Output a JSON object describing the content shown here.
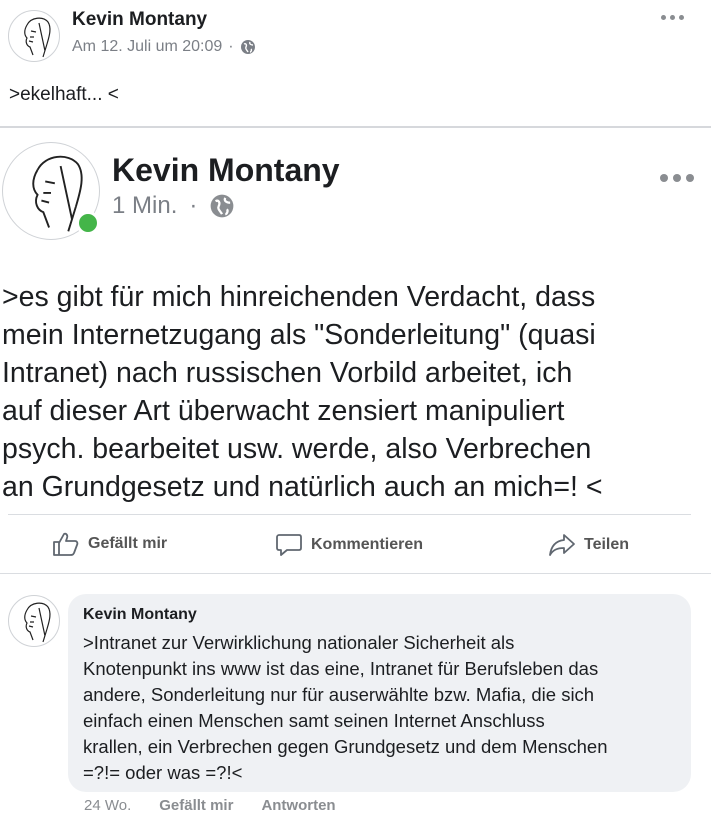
{
  "post1": {
    "author": "Kevin Montany",
    "timestamp": "Am 12. Juli um 20:09",
    "separator": "·",
    "privacy_icon": "globe-icon",
    "more_icon": "more-dots-icon",
    "text": ">ekelhaft... <"
  },
  "post2": {
    "author": "Kevin Montany",
    "timestamp": "1 Min.",
    "separator": "·",
    "privacy_icon": "globe-icon",
    "online_status_color": "#44b549",
    "more_icon": "more-dots-icon",
    "text_lines": [
      ">es gibt für mich hinreichenden Verdacht, dass",
      "mein Internetzugang als \"Sonderleitung\" (quasi",
      "Intranet) nach russischen Vorbild arbeitet, ich",
      "auf dieser Art überwacht zensiert manipuliert",
      "psych. bearbeitet usw. werde, also Verbrechen",
      "an Grundgesetz und natürlich auch an mich=! <"
    ]
  },
  "actions": {
    "like": "Gefällt mir",
    "comment": "Kommentieren",
    "share": "Teilen"
  },
  "comment": {
    "author": "Kevin Montany",
    "text_lines": [
      ">Intranet zur Verwirklichung nationaler Sicherheit als",
      "Knotenpunkt ins www ist das eine, Intranet für Berufsleben das",
      "andere, Sonderleitung nur für auserwählte bzw. Mafia, die sich",
      "einfach einen Menschen samt seinen Internet Anschluss",
      "krallen, ein Verbrechen gegen Grundgesetz und dem Menschen",
      "=?!= oder was =?!<"
    ],
    "footer": {
      "time": "24 Wo.",
      "like": "Gefällt mir",
      "reply": "Antworten"
    }
  },
  "colors": {
    "bubble": "#eff1f4",
    "meta_text": "#7b7f86",
    "divider": "#dadde1"
  }
}
